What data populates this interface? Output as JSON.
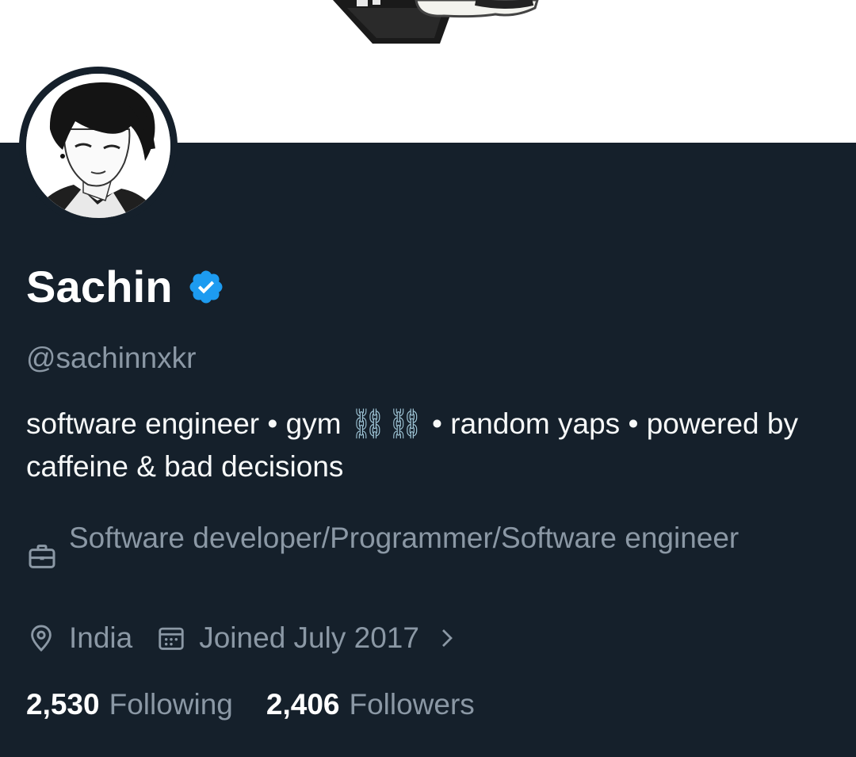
{
  "profile": {
    "name": "Sachin",
    "handle": "@sachinnxkr",
    "bio_text": "software engineer • gym ",
    "bio_emoji": "⛓⛓",
    "bio_rest": " • random yaps • powered by caffeine & bad decisions",
    "profession": "Software developer/Programmer/Software engineer",
    "location": "India",
    "joined": "Joined July 2017"
  },
  "stats": {
    "following_count": "2,530",
    "following_label": "Following",
    "followers_count": "2,406",
    "followers_label": "Followers"
  },
  "icons": {
    "verified": "verified-badge-icon",
    "profession": "briefcase-icon",
    "location": "location-pin-icon",
    "joined": "calendar-icon",
    "chevron": "chevron-right-icon"
  },
  "colors": {
    "background": "#15202b",
    "verified": "#1d9bf0",
    "secondary_text": "#8b98a5",
    "primary_text": "#f7f9f9"
  }
}
